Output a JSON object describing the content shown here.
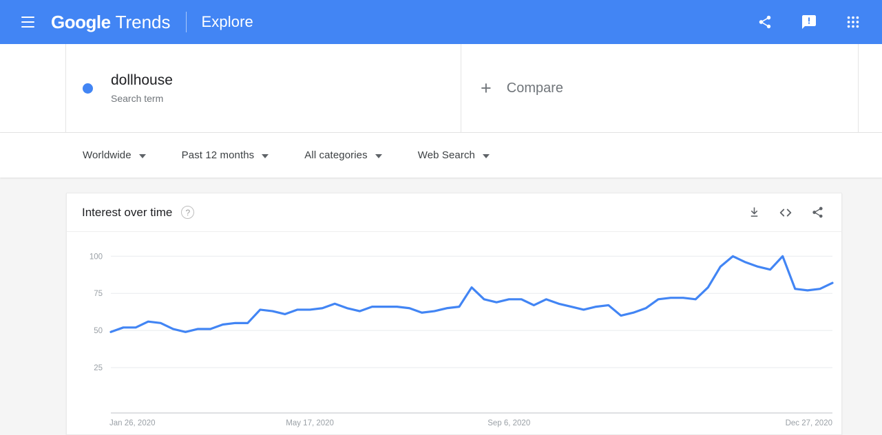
{
  "appbar": {
    "menu_icon": "hamburger-menu-icon",
    "brand_google": "Google",
    "brand_product": "Trends",
    "section": "Explore",
    "share_icon": "share-icon",
    "feedback_icon": "feedback-icon",
    "apps_icon": "apps-grid-icon",
    "background_color": "#4285f4"
  },
  "terms": {
    "search_term": {
      "label": "dollhouse",
      "type": "Search term",
      "dot_color": "#4285f4"
    },
    "compare": {
      "plus": "+",
      "label": "Compare"
    }
  },
  "filters": [
    {
      "label": "Worldwide"
    },
    {
      "label": "Past 12 months"
    },
    {
      "label": "All categories"
    },
    {
      "label": "Web Search"
    }
  ],
  "interest_card": {
    "title": "Interest over time",
    "help": "?",
    "download_icon": "download-icon",
    "embed_icon": "embed-code-icon",
    "share_icon": "share-icon"
  },
  "chart_data": {
    "type": "line",
    "title": "Interest over time",
    "xlabel": "",
    "ylabel": "",
    "ylim": [
      0,
      108
    ],
    "yticks": [
      25,
      50,
      75,
      100
    ],
    "ytick_labels": [
      "25",
      "50",
      "75",
      "100"
    ],
    "grid": true,
    "legend": false,
    "line_color": "#4285f4",
    "xtick_labels": [
      "Jan 26, 2020",
      "May 17, 2020",
      "Sep 6, 2020",
      "Dec 27, 2020"
    ],
    "xtick_indices": [
      0,
      16,
      32,
      48
    ],
    "series": [
      {
        "name": "dollhouse",
        "color": "#4285f4",
        "values": [
          49,
          52,
          52,
          56,
          55,
          51,
          49,
          51,
          51,
          54,
          55,
          55,
          64,
          63,
          61,
          64,
          64,
          65,
          68,
          65,
          63,
          66,
          66,
          66,
          65,
          62,
          63,
          65,
          66,
          79,
          71,
          69,
          71,
          71,
          67,
          71,
          68,
          66,
          64,
          66,
          67,
          60,
          62,
          65,
          71,
          72,
          72,
          71,
          79,
          93,
          100,
          96,
          93,
          91,
          100,
          78,
          77,
          78,
          82
        ]
      }
    ]
  }
}
